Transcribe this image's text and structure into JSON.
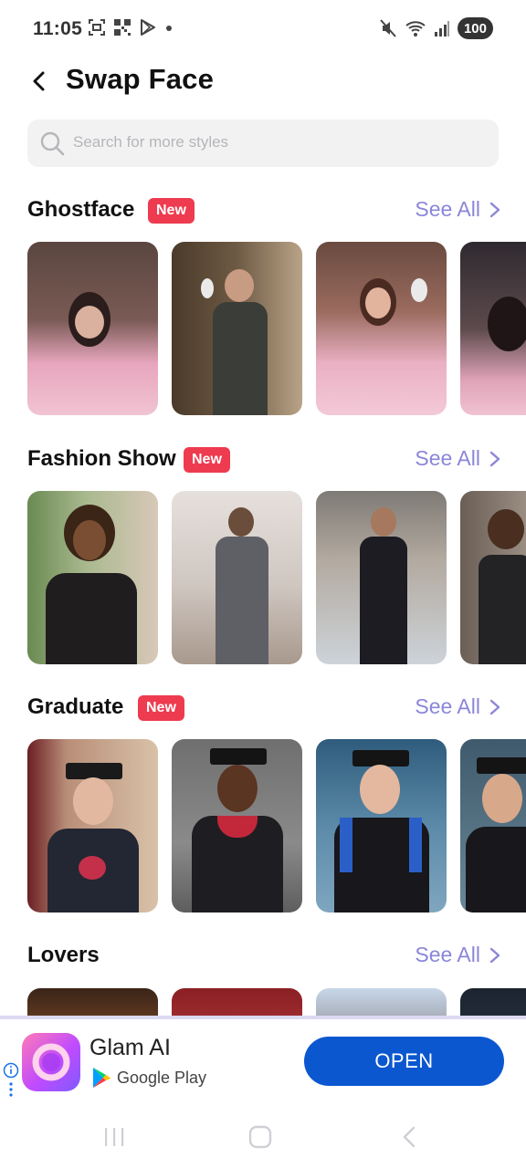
{
  "status_bar": {
    "time": "11:05",
    "battery": "100"
  },
  "header": {
    "title": "Swap Face"
  },
  "search": {
    "placeholder": "Search for more styles"
  },
  "sections": [
    {
      "title": "Ghostface",
      "badge": "New",
      "see_all": "See All"
    },
    {
      "title": "Fashion Show",
      "badge": "New",
      "see_all": "See All"
    },
    {
      "title": "Graduate",
      "badge": "New",
      "see_all": "See All"
    },
    {
      "title": "Lovers",
      "see_all": "See All"
    }
  ],
  "ad": {
    "app_name": "Glam AI",
    "store": "Google Play",
    "cta": "OPEN"
  },
  "colors": {
    "accent": "#8b86d8",
    "badge": "#ee3b4f",
    "cta": "#0b57d0"
  }
}
